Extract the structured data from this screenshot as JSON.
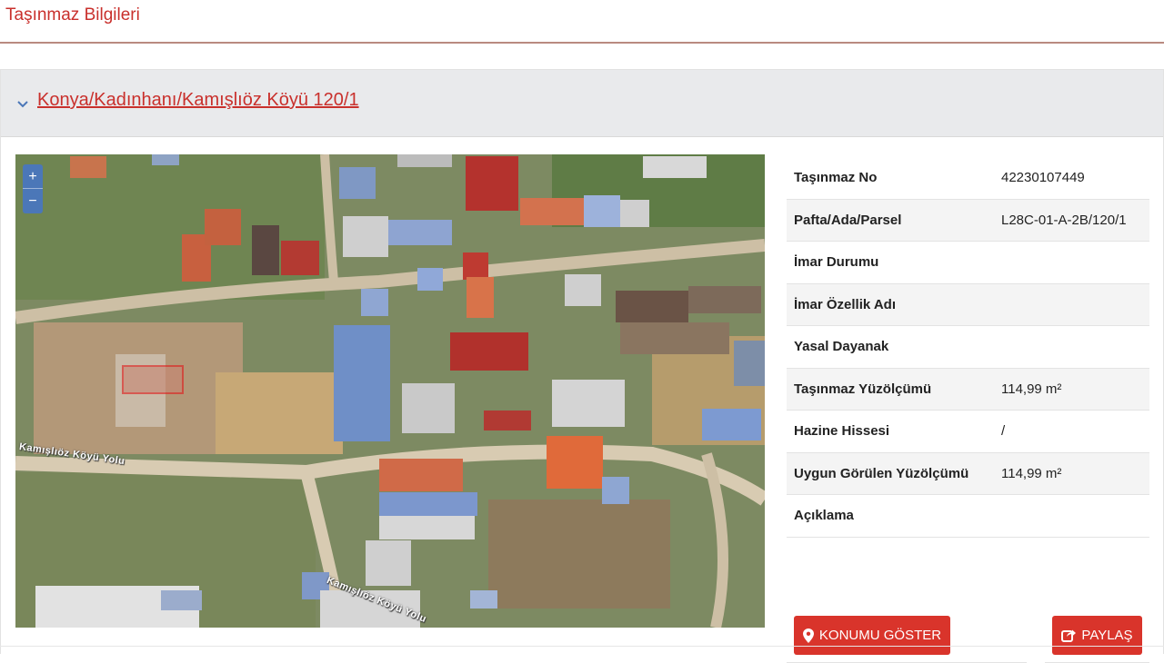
{
  "page": {
    "title": "Taşınmaz Bilgileri"
  },
  "panel": {
    "link": "Konya/Kadınhanı/Kamışlıöz Köyü 120/1"
  },
  "map": {
    "zoom_in": "+",
    "zoom_out": "−",
    "road_labels": [
      "Kamışlıöz Köyü Yolu",
      "Kamışlıöz Köyü Yolu"
    ]
  },
  "info_rows": [
    {
      "label": "Taşınmaz No",
      "value": "42230107449"
    },
    {
      "label": "Pafta/Ada/Parsel",
      "value": "L28C-01-A-2B/120/1"
    },
    {
      "label": "İmar Durumu",
      "value": ""
    },
    {
      "label": "İmar Özellik Adı",
      "value": ""
    },
    {
      "label": "Yasal Dayanak",
      "value": ""
    },
    {
      "label": "Taşınmaz Yüzölçümü",
      "value": "114,99 m²"
    },
    {
      "label": "Hazine Hissesi",
      "value": "/"
    },
    {
      "label": "Uygun Görülen Yüzölçümü",
      "value": "114,99 m²"
    },
    {
      "label": "Açıklama",
      "value": ""
    }
  ],
  "buttons": {
    "show_location": "KONUMU GÖSTER",
    "share": "PAYLAŞ"
  },
  "icons": {
    "chevron": "chevron-down-icon",
    "location": "map-marker-icon",
    "share": "share-icon"
  },
  "colors": {
    "accent": "#c9302c",
    "button": "#d9342b",
    "zoom": "#4b77b8"
  }
}
